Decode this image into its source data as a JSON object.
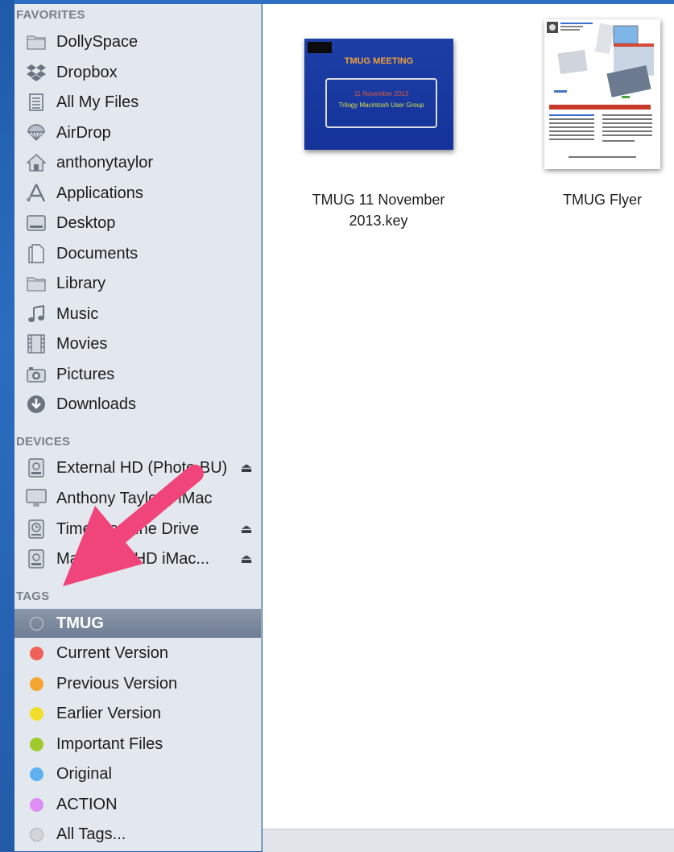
{
  "sidebar": {
    "favorites_header": "FAVORITES",
    "favorites": [
      {
        "label": "DollySpace",
        "icon": "folder-icon"
      },
      {
        "label": "Dropbox",
        "icon": "dropbox-icon"
      },
      {
        "label": "All My Files",
        "icon": "all-files-icon"
      },
      {
        "label": "AirDrop",
        "icon": "airdrop-icon"
      },
      {
        "label": "anthonytaylor",
        "icon": "home-icon"
      },
      {
        "label": "Applications",
        "icon": "applications-icon"
      },
      {
        "label": "Desktop",
        "icon": "desktop-icon"
      },
      {
        "label": "Documents",
        "icon": "documents-icon"
      },
      {
        "label": "Library",
        "icon": "folder-icon"
      },
      {
        "label": "Music",
        "icon": "music-icon"
      },
      {
        "label": "Movies",
        "icon": "movies-icon"
      },
      {
        "label": "Pictures",
        "icon": "camera-icon"
      },
      {
        "label": "Downloads",
        "icon": "downloads-icon"
      }
    ],
    "devices_header": "DEVICES",
    "devices": [
      {
        "label": "External HD (Photo BU)",
        "icon": "external-drive-icon",
        "eject": "⏏"
      },
      {
        "label": "Anthony Taylor's iMac",
        "icon": "imac-icon",
        "eject": ""
      },
      {
        "label": "Time Machine Drive",
        "icon": "time-machine-drive-icon",
        "eject": "⏏"
      },
      {
        "label": "Macintosh HD iMac...",
        "icon": "external-drive-icon",
        "eject": "⏏"
      }
    ],
    "tags_header": "TAGS",
    "tags": [
      {
        "label": "TMUG",
        "color": "#c9ced6",
        "selected": true
      },
      {
        "label": "Current Version",
        "color": "#f0605a"
      },
      {
        "label": "Previous Version",
        "color": "#f5a631"
      },
      {
        "label": "Earlier Version",
        "color": "#f1de2a"
      },
      {
        "label": "Important Files",
        "color": "#9ecb2b"
      },
      {
        "label": "Original",
        "color": "#5fb0f0"
      },
      {
        "label": "ACTION",
        "color": "#dc8ef2"
      },
      {
        "label": "All Tags...",
        "color": "#c6c9cf"
      }
    ]
  },
  "files": [
    {
      "name_line1": "TMUG 11 November",
      "name_line2": "2013.key",
      "type": "keynote"
    },
    {
      "name_line1": "TMUG Flyer",
      "name_line2": "",
      "type": "document"
    }
  ],
  "keynote_thumb": {
    "title": "TMUG MEETING",
    "date": "11 November 2013",
    "group": "Trilogy Macintosh User Group"
  },
  "flyer_thumb": {
    "heading": "Macintosh Computer",
    "iphone": "iPhone",
    "ipad": "iPad",
    "group": "Trilogy Macintosh User Group"
  },
  "colors": {
    "sidebar_bg": "#e3e8ee",
    "selected_tag_bg": "#7a879b",
    "arrow": "#f0457a",
    "desktop": "#2a63b5"
  }
}
